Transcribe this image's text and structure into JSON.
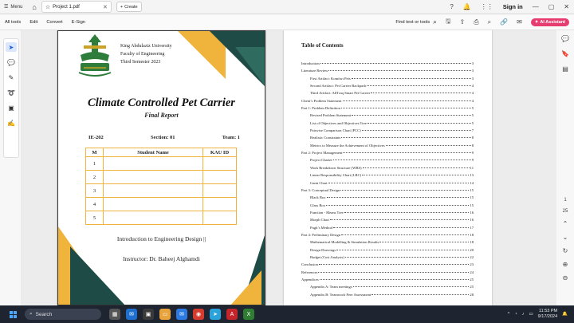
{
  "app": {
    "menu_label": "Menu",
    "tab_title": "Project 1.pdf",
    "new_tab_label": "Create",
    "sign_in": "Sign in"
  },
  "toolbar": {
    "items": [
      "All tools",
      "Edit",
      "Convert",
      "E-Sign"
    ],
    "find_label": "Find text or tools",
    "ai_label": "AI Assistant"
  },
  "page_nav": {
    "current": "1",
    "total": "25"
  },
  "cover": {
    "university": "King Abdulaziz University",
    "faculty": "Faculty of Engineering",
    "semester": "Third Semester 2023",
    "title": "Climate Controlled Pet Carrier",
    "subtitle": "Final Report",
    "course_code": "IE-202",
    "section": "Section: 01",
    "team": "Team: 1",
    "table_headers": [
      "M",
      "Student Name",
      "KAU ID"
    ],
    "rows": [
      "1",
      "2",
      "3",
      "4",
      "5"
    ],
    "course_name": "Introduction to Engineering Design ||",
    "instructor": "Instructor: Dr. Baheej Alghamdi"
  },
  "toc": {
    "title": "Table of Contents",
    "entries": [
      {
        "label": "Introduction",
        "page": "3",
        "level": 1
      },
      {
        "label": "Literature Review",
        "page": "3",
        "level": 1
      },
      {
        "label": "First Artifact: Komfort Pets",
        "page": "3",
        "level": 2
      },
      {
        "label": "Second Artifact: Pet Carrier Backpack",
        "page": "4",
        "level": 2
      },
      {
        "label": "Third Artifact: AllTraq Smart Pet Carrier",
        "page": "4",
        "level": 2
      },
      {
        "label": "Client’s Problem Statement",
        "page": "4",
        "level": 1
      },
      {
        "label": "Part 1: Problem Definition",
        "page": "5",
        "level": 1
      },
      {
        "label": "Revised Problem Statement",
        "page": "5",
        "level": 2
      },
      {
        "label": "List of Objectives and Objectives Tree",
        "page": "5",
        "level": 2
      },
      {
        "label": "Pairwise Comparison Chart (PCC)",
        "page": "7",
        "level": 2
      },
      {
        "label": "Realistic Constraints",
        "page": "8",
        "level": 2
      },
      {
        "label": "Metrics to Measure the Achievement of Objectives",
        "page": "8",
        "level": 2
      },
      {
        "label": "Part 2: Project Management",
        "page": "9",
        "level": 1
      },
      {
        "label": "Project Charter",
        "page": "9",
        "level": 2
      },
      {
        "label": "Work Breakdown Structure (WBS)",
        "page": "11",
        "level": 2
      },
      {
        "label": "Linear Responsibility Chart (LRC)",
        "page": "13",
        "level": 2
      },
      {
        "label": "Gantt Chart",
        "page": "14",
        "level": 2
      },
      {
        "label": "Part 3: Conceptual Design",
        "page": "15",
        "level": 1
      },
      {
        "label": "Black Box",
        "page": "15",
        "level": 2
      },
      {
        "label": "Glass Box",
        "page": "15",
        "level": 2
      },
      {
        "label": "Function - Means Tree",
        "page": "16",
        "level": 2
      },
      {
        "label": "Morph Chart",
        "page": "16",
        "level": 2
      },
      {
        "label": "Pugh’s Method",
        "page": "17",
        "level": 2
      },
      {
        "label": "Part 4: Preliminary Design",
        "page": "18",
        "level": 1
      },
      {
        "label": "Mathematical Modelling & Simulation Results",
        "page": "18",
        "level": 2
      },
      {
        "label": "Design Drawings",
        "page": "20",
        "level": 2
      },
      {
        "label": "Budget (Cost Analysis)",
        "page": "22",
        "level": 2
      },
      {
        "label": "Conclusion",
        "page": "23",
        "level": 1
      },
      {
        "label": "References",
        "page": "24",
        "level": 1
      },
      {
        "label": "Appendices",
        "page": "25",
        "level": 1
      },
      {
        "label": "Appendix A: Team meetings",
        "page": "25",
        "level": 2
      },
      {
        "label": "Appendix B: Teamwork Peer Assessment",
        "page": "28",
        "level": 2
      }
    ]
  },
  "taskbar": {
    "search_placeholder": "Search",
    "time": "11:53 PM",
    "date": "9/17/2024"
  },
  "colors": {
    "accent_yellow": "#f0b43c",
    "accent_dark": "#1f4b46",
    "ai_button": "#e63c70"
  }
}
